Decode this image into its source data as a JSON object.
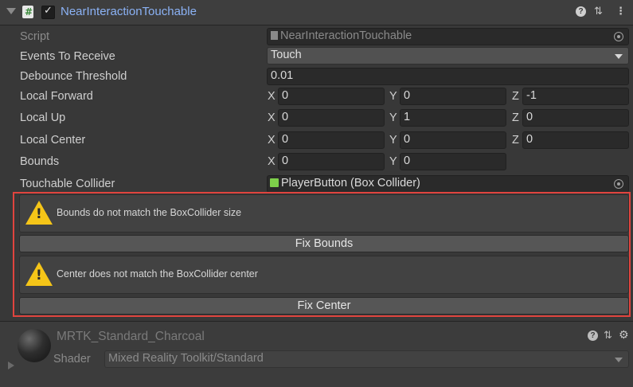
{
  "component": {
    "title": "NearInteractionTouchable",
    "enabled": true
  },
  "icons": {
    "help": "?",
    "preset": "⇅",
    "menu": "⋮",
    "settings": "⚙"
  },
  "fields": {
    "script": {
      "label": "Script",
      "value": "NearInteractionTouchable"
    },
    "events": {
      "label": "Events To Receive",
      "value": "Touch"
    },
    "debounce": {
      "label": "Debounce Threshold",
      "value": "0.01"
    },
    "local_forward": {
      "label": "Local Forward",
      "x": "0",
      "y": "0",
      "z": "-1"
    },
    "local_up": {
      "label": "Local Up",
      "x": "0",
      "y": "1",
      "z": "0"
    },
    "local_center": {
      "label": "Local Center",
      "x": "0",
      "y": "0",
      "z": "0"
    },
    "bounds": {
      "label": "Bounds",
      "x": "0",
      "y": "0"
    },
    "collider": {
      "label": "Touchable Collider",
      "value": "PlayerButton (Box Collider)"
    }
  },
  "axes": {
    "x": "X",
    "y": "Y",
    "z": "Z"
  },
  "warnings": {
    "bounds": {
      "text": "Bounds do not match the BoxCollider size",
      "button": "Fix Bounds"
    },
    "center": {
      "text": "Center does not match the BoxCollider center",
      "button": "Fix Center"
    }
  },
  "material": {
    "name": "MRTK_Standard_Charcoal",
    "shader_label": "Shader",
    "shader_value": "Mixed Reality Toolkit/Standard"
  },
  "colors": {
    "title_link": "#8bb2f5",
    "highlight_border": "#e0443e",
    "warning": "#f5c518",
    "background": "#383838"
  }
}
